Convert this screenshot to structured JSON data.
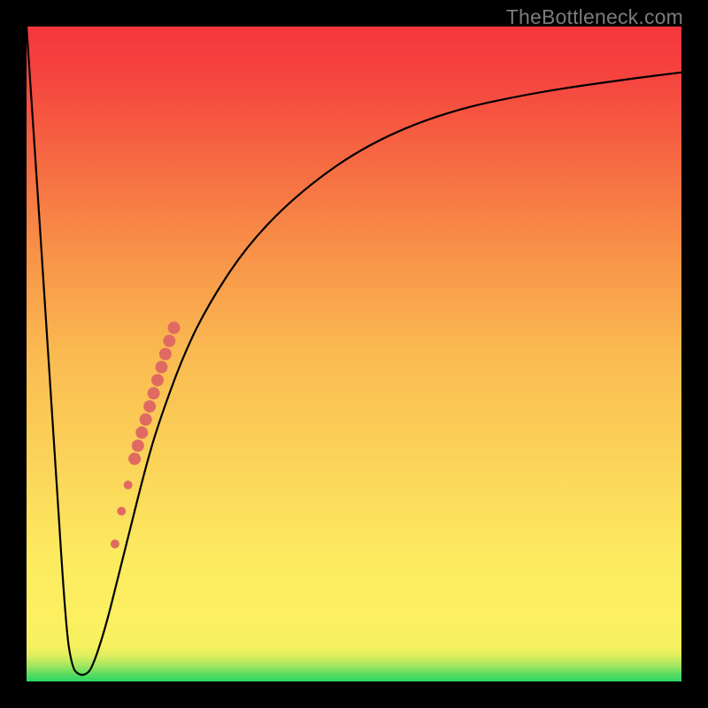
{
  "watermark": "TheBottleneck.com",
  "chart_data": {
    "type": "line",
    "title": "",
    "xlabel": "",
    "ylabel": "",
    "ylim": [
      0,
      100
    ],
    "xlim": [
      0,
      100
    ],
    "series": [
      {
        "name": "bottleneck-curve",
        "x": [
          0,
          4,
          6,
          7,
          8,
          9,
          10,
          12,
          14,
          16,
          18,
          20,
          24,
          28,
          34,
          42,
          52,
          64,
          78,
          92,
          100
        ],
        "values": [
          100,
          40,
          8,
          2,
          1,
          1,
          2,
          8,
          16,
          24,
          32,
          39,
          50,
          58,
          67,
          75,
          82,
          87,
          90,
          92,
          93
        ]
      }
    ],
    "markers": {
      "name": "highlight-dots",
      "color": "#e06a62",
      "points": [
        {
          "x": 13.5,
          "value": 21,
          "r": 5
        },
        {
          "x": 14.5,
          "value": 26,
          "r": 5
        },
        {
          "x": 15.5,
          "value": 30,
          "r": 5
        },
        {
          "x": 16.5,
          "value": 34,
          "r": 7
        },
        {
          "x": 17.0,
          "value": 36,
          "r": 7
        },
        {
          "x": 17.6,
          "value": 38,
          "r": 7
        },
        {
          "x": 18.2,
          "value": 40,
          "r": 7
        },
        {
          "x": 18.8,
          "value": 42,
          "r": 7
        },
        {
          "x": 19.4,
          "value": 44,
          "r": 7
        },
        {
          "x": 20.0,
          "value": 46,
          "r": 7
        },
        {
          "x": 20.6,
          "value": 48,
          "r": 7
        },
        {
          "x": 21.2,
          "value": 50,
          "r": 7
        },
        {
          "x": 21.8,
          "value": 52,
          "r": 7
        },
        {
          "x": 22.5,
          "value": 54,
          "r": 7
        }
      ]
    }
  }
}
